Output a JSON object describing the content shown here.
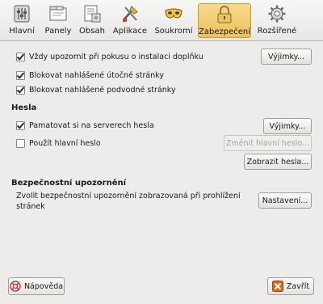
{
  "tabs": [
    {
      "label": "Hlavní",
      "icon": "sliders-icon"
    },
    {
      "label": "Panely",
      "icon": "tabs-icon"
    },
    {
      "label": "Obsah",
      "icon": "content-icon"
    },
    {
      "label": "Aplikace",
      "icon": "applications-icon"
    },
    {
      "label": "Soukromí",
      "icon": "privacy-mask-icon"
    },
    {
      "label": "Zabezpečení",
      "icon": "lock-icon",
      "active": true
    },
    {
      "label": "Rozšířené",
      "icon": "gear-icon"
    }
  ],
  "security": {
    "addons_warn_label": "Vždy upozornit při pokusu o instalaci doplňku",
    "addons_warn_checked": true,
    "exceptions_label": "Výjimky...",
    "block_attack_label": "Blokovat nahlášené útočné stránky",
    "block_attack_checked": true,
    "block_forgery_label": "Blokovat nahlášené podvodné stránky",
    "block_forgery_checked": true
  },
  "passwords": {
    "heading": "Hesla",
    "remember_label": "Pamatovat si na serverech hesla",
    "remember_checked": true,
    "exceptions_label": "Výjimky...",
    "master_label": "Použít hlavní heslo",
    "master_checked": false,
    "change_master_label": "Změnit hlavní heslo...",
    "show_passwords_label": "Zobrazit hesla..."
  },
  "warnings": {
    "heading": "Bezpečnostní upozornění",
    "description": "Zvolit bezpečnostní upozornění zobrazovaná při prohlížení stránek",
    "settings_label": "Nastavení..."
  },
  "footer": {
    "help_label": "Nápověda",
    "close_label": "Zavřít"
  },
  "colors": {
    "active_tab": "#eec15b",
    "close_icon": "#e0641b",
    "help_icon": "#c83c3c"
  }
}
